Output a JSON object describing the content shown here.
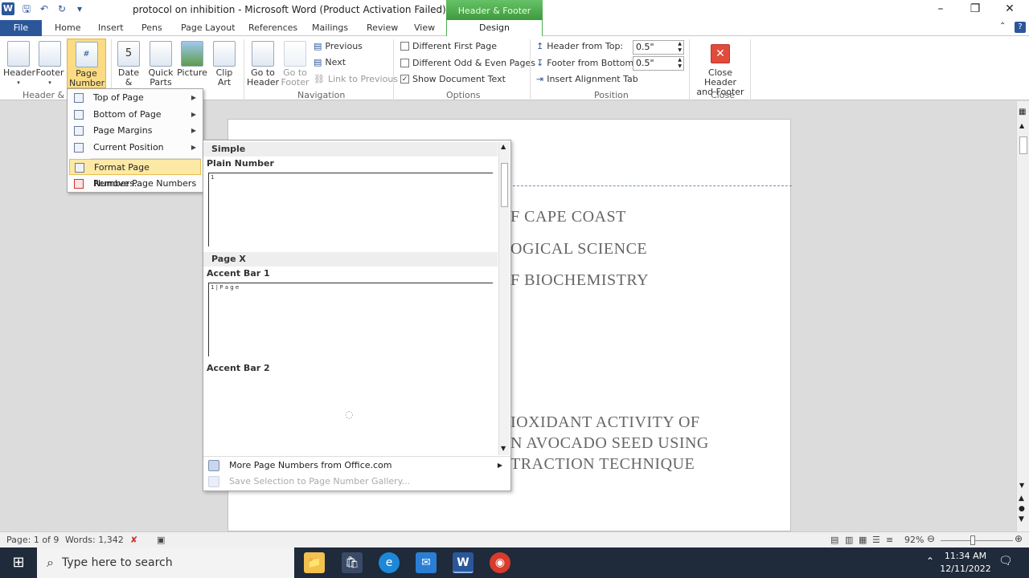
{
  "titlebar": {
    "title": "protocol on inhibition - Microsoft Word (Product Activation Failed)",
    "contextual_tab_group": "Header & Footer Tools",
    "app_icon": "W"
  },
  "tabs": [
    "File",
    "Home",
    "Insert",
    "Pens",
    "Page Layout",
    "References",
    "Mailings",
    "Review",
    "View",
    "Design"
  ],
  "ribbon": {
    "header_footer_group": {
      "header": "Header",
      "footer": "Footer",
      "page_number": "Page Number",
      "label": "Header & F"
    },
    "insert_group": {
      "date_time": "Date & Time",
      "quick_parts": "Quick Parts",
      "picture": "Picture",
      "clip_art": "Clip Art"
    },
    "navigation_group": {
      "go_to_header": "Go to Header",
      "go_to_footer": "Go to Footer",
      "previous": "Previous",
      "next": "Next",
      "link_to_previous": "Link to Previous",
      "label": "Navigation"
    },
    "options_group": {
      "different_first_page": "Different First Page",
      "different_odd_even": "Different Odd & Even Pages",
      "show_document_text": "Show Document Text",
      "label": "Options"
    },
    "position_group": {
      "header_from_top_label": "Header from Top:",
      "header_from_top_value": "0.5\"",
      "footer_from_bottom_label": "Footer from Bottom:",
      "footer_from_bottom_value": "0.5\"",
      "insert_alignment_tab": "Insert Alignment Tab",
      "label": "Position"
    },
    "close_group": {
      "close_header_footer": "Close Header and Footer",
      "label": "Close"
    }
  },
  "page_number_menu": {
    "items": [
      {
        "label": "Top of Page"
      },
      {
        "label": "Bottom of Page"
      },
      {
        "label": "Page Margins"
      },
      {
        "label": "Current Position"
      },
      {
        "label": "Format Page Numbers..."
      },
      {
        "label": "Remove Page Numbers"
      }
    ]
  },
  "gallery": {
    "section_simple": "Simple",
    "plain_number": "Plain Number",
    "plain_number_preview": "1",
    "section_page_x": "Page X",
    "accent_bar_1": "Accent Bar 1",
    "accent_bar_1_preview": "1 | P a g e",
    "accent_bar_2": "Accent Bar 2",
    "more_from_office": "More Page Numbers from Office.com",
    "save_selection": "Save Selection to Page Number Gallery..."
  },
  "document": {
    "lines": [
      "F CAPE COAST",
      "OGICAL  SCIENCE",
      "F BIOCHEMISTRY",
      "IOXIDANT ACTIVITY OF",
      "N AVOCADO SEED USING",
      "TRACTION TECHNIQUE"
    ]
  },
  "statusbar": {
    "page": "Page: 1 of 9",
    "words": "Words: 1,342",
    "zoom": "92%"
  },
  "taskbar": {
    "search_placeholder": "Type here to search",
    "time": "11:34 AM",
    "date": "12/11/2022"
  }
}
